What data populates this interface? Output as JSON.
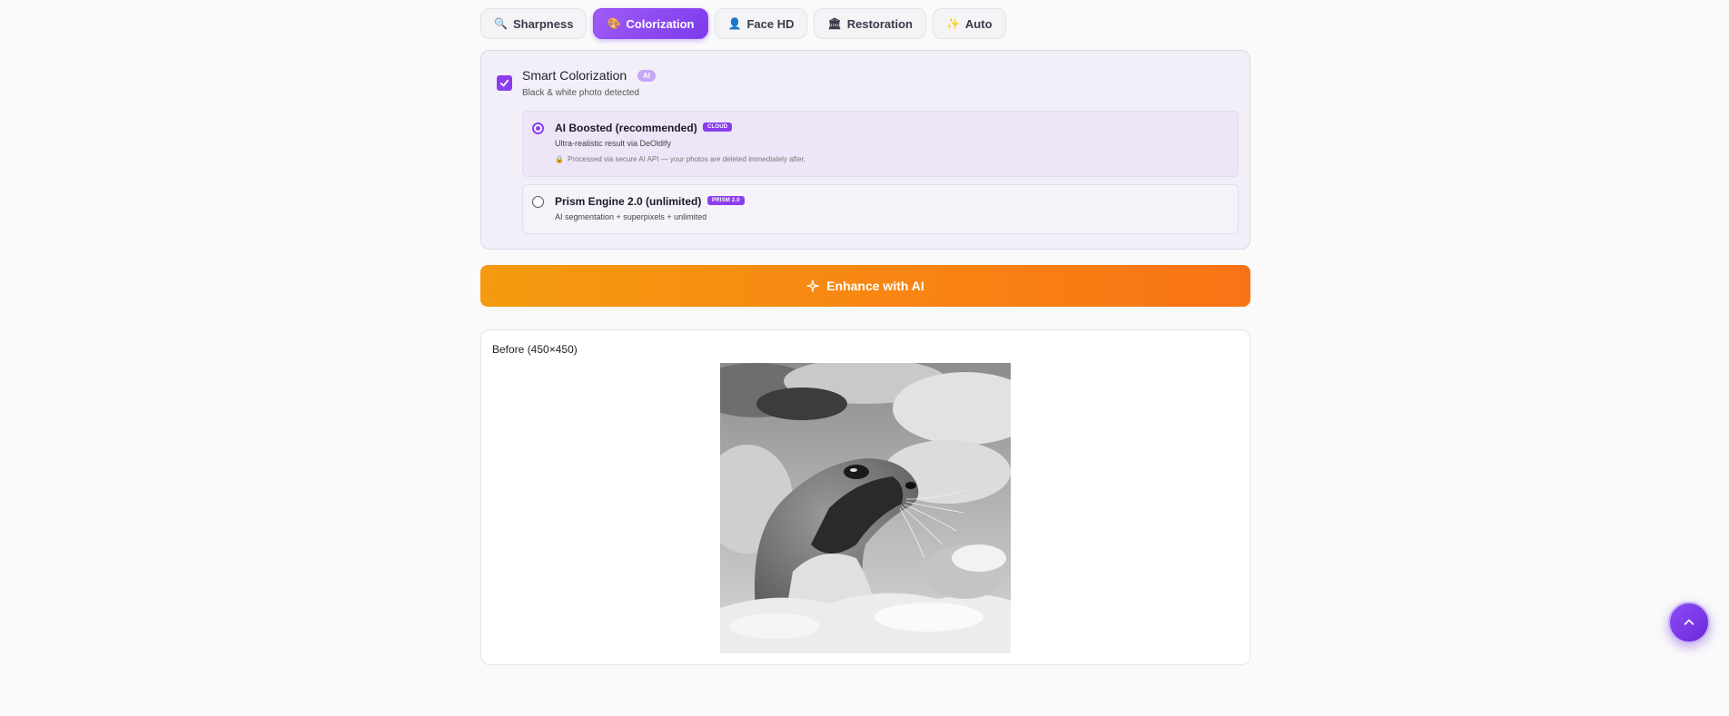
{
  "tabs": [
    {
      "label": "Sharpness",
      "icon": "magnifier-icon",
      "glyph": "🔍",
      "active": false
    },
    {
      "label": "Colorization",
      "icon": "palette-icon",
      "glyph": "🎨",
      "active": true
    },
    {
      "label": "Face HD",
      "icon": "person-icon",
      "glyph": "👤",
      "active": false
    },
    {
      "label": "Restoration",
      "icon": "building-icon",
      "glyph": "🏛",
      "active": false
    },
    {
      "label": "Auto",
      "icon": "sparkles-icon",
      "glyph": "✨",
      "active": false
    }
  ],
  "colorization": {
    "checked": true,
    "title": "Smart Colorization",
    "badge": "AI",
    "subtitle": "Black & white photo detected",
    "options": [
      {
        "title": "AI Boosted (recommended)",
        "badge": "CLOUD",
        "description": "Ultra-realistic result via DeOldify",
        "note": "Processed via secure AI API — your photos are deleted immediately after.",
        "selected": true
      },
      {
        "title": "Prism Engine 2.0 (unlimited)",
        "badge": "PRISM 2.0",
        "description": "AI segmentation + superpixels + unlimited",
        "selected": false
      }
    ]
  },
  "enhance_button": {
    "label": "Enhance with AI",
    "icon": "sparkle-icon"
  },
  "preview": {
    "label": "Before (450×450)"
  },
  "colors": {
    "accent": "#8b3cf0",
    "enhance_start": "#f59b0f",
    "enhance_end": "#f97316",
    "panel_bg": "#f3eff9"
  }
}
